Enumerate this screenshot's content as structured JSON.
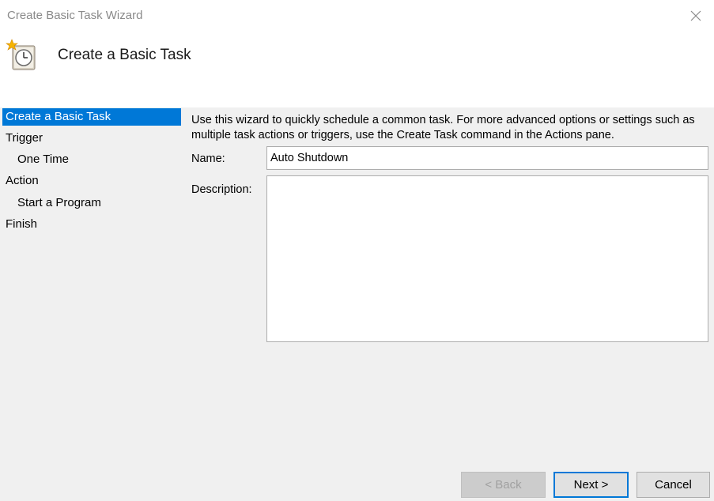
{
  "window": {
    "title": "Create Basic Task Wizard"
  },
  "header": {
    "title": "Create a Basic Task"
  },
  "nav": {
    "items": [
      {
        "label": "Create a Basic Task"
      },
      {
        "label": "Trigger"
      },
      {
        "label": "One Time"
      },
      {
        "label": "Action"
      },
      {
        "label": "Start a Program"
      },
      {
        "label": "Finish"
      }
    ]
  },
  "content": {
    "intro": "Use this wizard to quickly schedule a common task.  For more advanced options or settings such as multiple task actions or triggers, use the Create Task command in the Actions pane.",
    "name_label": "Name:",
    "name_value": "Auto Shutdown",
    "description_label": "Description:",
    "description_value": ""
  },
  "buttons": {
    "back": "< Back",
    "next": "Next >",
    "cancel": "Cancel"
  },
  "colors": {
    "selection": "#0078d7",
    "window_bg": "#f0f0f0",
    "header_bg": "#ffffff"
  }
}
